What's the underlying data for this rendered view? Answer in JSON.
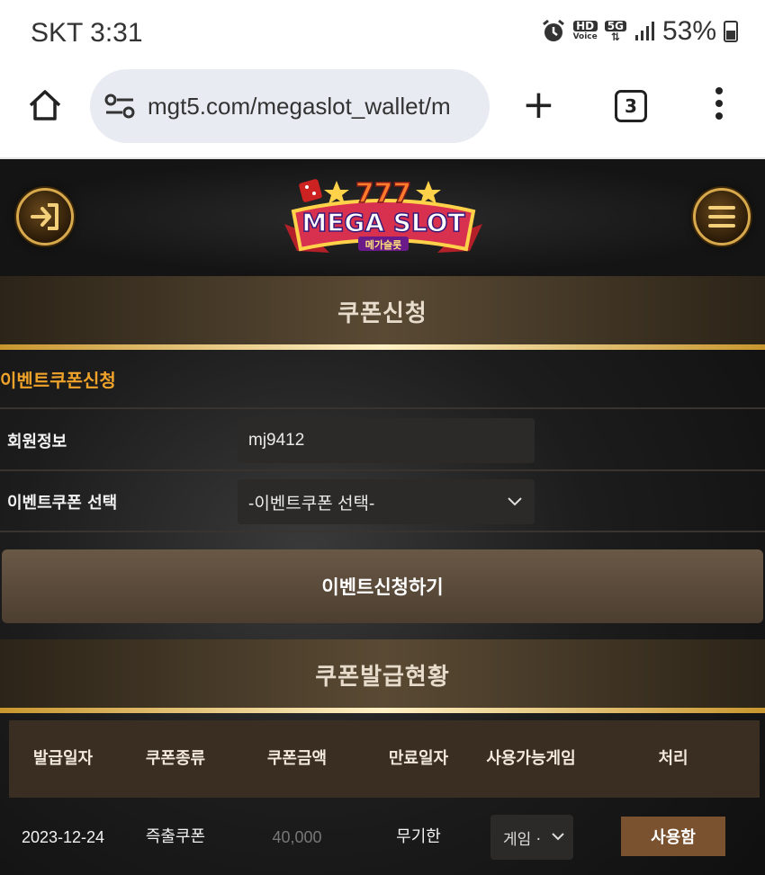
{
  "status_bar": {
    "carrier_time": "SKT 3:31",
    "battery": "53%",
    "hd_label": "HD",
    "voice_label": "Voice",
    "network_label": "5G"
  },
  "browser": {
    "url": "mgt5.com/megaslot_wallet/m",
    "tab_count": "3"
  },
  "site": {
    "logo_text": "MEGA SLOT",
    "logo_sub": "메가슬롯",
    "coupon_apply_title": "쿠폰신청",
    "event_section_label": "이벤트쿠폰신청",
    "member_info_label": "회원정보",
    "member_info_value": "mj9412",
    "coupon_select_label": "이벤트쿠폰 선택",
    "coupon_select_value": "-이벤트쿠폰 선택-",
    "apply_button": "이벤트신청하기",
    "issue_status_title": "쿠폰발급현황",
    "table": {
      "headers": [
        "발급일자",
        "쿠폰종류",
        "쿠폰금액",
        "만료일자",
        "사용가능게임",
        "처리"
      ],
      "rows": [
        {
          "issued_date": "2023-12-24",
          "coupon_type": "즉출쿠폰",
          "amount": "40,000",
          "expiry": "무기한",
          "game": "게임 ·",
          "action": "사용함"
        }
      ]
    }
  }
}
